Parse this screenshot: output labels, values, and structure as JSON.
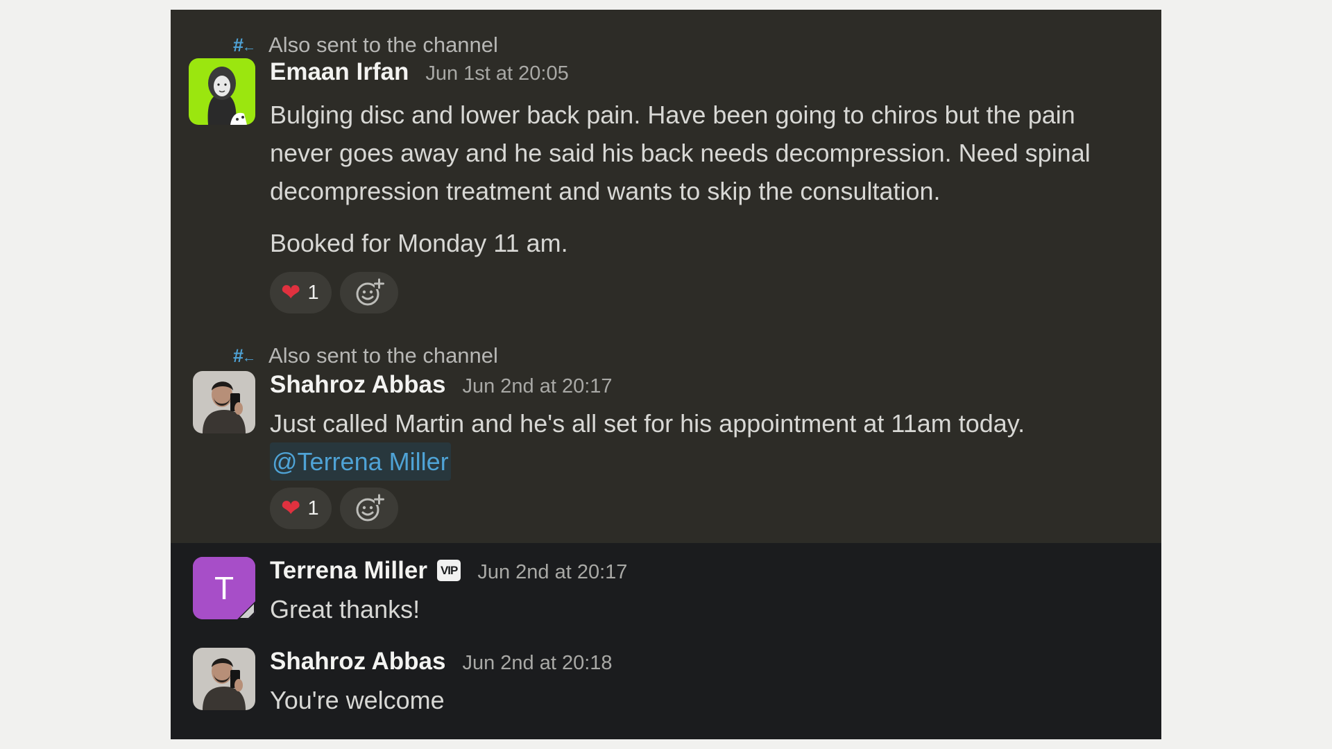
{
  "thread_notice": "Also sent to the channel",
  "messages": [
    {
      "author": "Emaan Irfan",
      "time": "Jun 1st at 20:05",
      "text": "Bulging disc and lower back pain. Have been going to chiros but the pain never goes away and he said his back needs decompression. Need spinal decompression treatment and wants to skip the consultation.",
      "text2": "Booked for Monday 11 am.",
      "reaction_emoji": "❤",
      "reaction_count": "1",
      "avatar_icon": "avatar-photo",
      "avatar_bg": "#9be60f"
    },
    {
      "author": "Shahroz Abbas",
      "time": "Jun 2nd at 20:17",
      "text": "Just called Martin and he's all set for his appointment at 11am today.",
      "mention": "@Terrena Miller",
      "reaction_emoji": "❤",
      "reaction_count": "1",
      "avatar_icon": "avatar-photo"
    },
    {
      "author": "Terrena Miller",
      "badge": "VIP",
      "time": "Jun 2nd at 20:17",
      "text": "Great thanks!",
      "avatar_letter": "T",
      "avatar_bg": "#a74ec8"
    },
    {
      "author": "Shahroz Abbas",
      "time": "Jun 2nd at 20:18",
      "text": "You're welcome",
      "avatar_icon": "avatar-photo"
    }
  ],
  "colors": {
    "thread_icon": "#4fa3d6",
    "highlight_bg": "#2d2c27",
    "panel_bg": "#1b1c1e",
    "mention": "#4fa3d6",
    "heart": "#e0313f"
  }
}
